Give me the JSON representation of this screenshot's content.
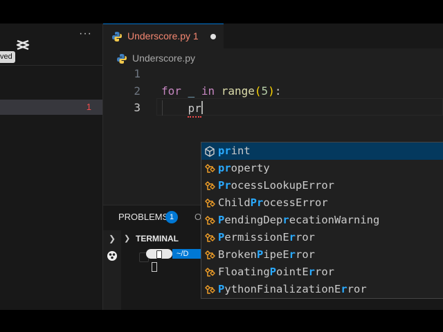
{
  "sidebar": {
    "more_label": "···",
    "saved_badge": "ved",
    "file_problem_count": "1"
  },
  "tab": {
    "label": "Underscore.py 1"
  },
  "breadcrumb": {
    "file": "Underscore.py"
  },
  "editor": {
    "line_numbers": [
      "1",
      "2",
      "3"
    ],
    "line2": {
      "kw_for": "for",
      "var": "_",
      "kw_in": "in",
      "fn": "range",
      "open": "(",
      "num": "5",
      "close": ")",
      "colon": ":"
    },
    "line3_typed": "pr"
  },
  "suggestions": [
    {
      "kind": "method",
      "parts": [
        [
          "pr",
          true
        ],
        [
          "int",
          false
        ]
      ]
    },
    {
      "kind": "class",
      "parts": [
        [
          "pr",
          true
        ],
        [
          "operty",
          false
        ]
      ]
    },
    {
      "kind": "class",
      "parts": [
        [
          "Pr",
          true
        ],
        [
          "ocessLookupError",
          false
        ]
      ]
    },
    {
      "kind": "class",
      "parts": [
        [
          "Child",
          false
        ],
        [
          "Pr",
          true
        ],
        [
          "ocessError",
          false
        ]
      ]
    },
    {
      "kind": "class",
      "parts": [
        [
          "P",
          true
        ],
        [
          "endingDep",
          false
        ],
        [
          "r",
          true
        ],
        [
          "ecationWarning",
          false
        ]
      ]
    },
    {
      "kind": "class",
      "parts": [
        [
          "P",
          true
        ],
        [
          "ermissionE",
          false
        ],
        [
          "r",
          true
        ],
        [
          "ror",
          false
        ]
      ]
    },
    {
      "kind": "class",
      "parts": [
        [
          "Broken",
          false
        ],
        [
          "P",
          true
        ],
        [
          "ipeE",
          false
        ],
        [
          "r",
          true
        ],
        [
          "ror",
          false
        ]
      ]
    },
    {
      "kind": "class",
      "parts": [
        [
          "Floating",
          false
        ],
        [
          "P",
          true
        ],
        [
          "ointE",
          false
        ],
        [
          "r",
          true
        ],
        [
          "ror",
          false
        ]
      ]
    },
    {
      "kind": "class",
      "parts": [
        [
          "P",
          true
        ],
        [
          "ythonFinalizationE",
          false
        ],
        [
          "r",
          true
        ],
        [
          "ror",
          false
        ]
      ]
    }
  ],
  "panel": {
    "problems_label": "PROBLEMS",
    "problems_count": "1",
    "output_label": "O",
    "terminal_label": "TERMINAL",
    "prompt_path": "~/D"
  },
  "colors": {
    "accent": "#0078d4",
    "error": "#f14c4c",
    "match_highlight": "#2aaaff",
    "selected_suggestion": "#04395e"
  }
}
